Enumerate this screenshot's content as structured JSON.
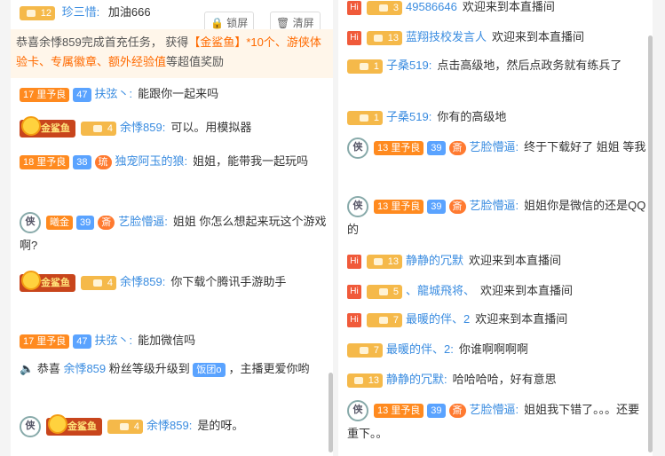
{
  "left": {
    "top_row": {
      "level": "12",
      "name": "珍三惜:",
      "msg": "加油666"
    },
    "buttons": {
      "lock": "锁屏",
      "clear": "清屏"
    },
    "notice": {
      "pre": "恭喜余悸859完成首充任务， 获得",
      "items": "【金鲨鱼】*10个、游侠体验卡、专属徽章、额外经验值",
      "post": "等超值奖励"
    },
    "rows": [
      {
        "badges": [
          {
            "type": "orange",
            "text": "里予良",
            "lv": "17"
          },
          {
            "type": "blue",
            "text": "47"
          }
        ],
        "name": "扶弦丶:",
        "msg": "能跟你一起来吗"
      },
      {
        "badges": [
          {
            "type": "gold",
            "text": "金鲨鱼"
          },
          {
            "type": "lvl",
            "text": "4"
          }
        ],
        "name": "余悸859:",
        "msg": "可以。用模拟器"
      },
      {
        "badges": [
          {
            "type": "orange",
            "text": "里予良",
            "lv": "18"
          },
          {
            "type": "blue",
            "text": "38"
          },
          {
            "type": "round",
            "text": "琉"
          }
        ],
        "name": "独宠阿玉的狼:",
        "msg": "姐姐，能带我一起玩吗"
      },
      {
        "badges": [
          {
            "type": "shield",
            "text": "侠"
          },
          {
            "type": "orange",
            "text": "曦金"
          },
          {
            "type": "blue",
            "text": "39"
          },
          {
            "type": "round",
            "text": "斎"
          }
        ],
        "name": "艺脸懵逼:",
        "msg": "姐姐 你怎么想起来玩这个游戏啊?"
      },
      {
        "badges": [
          {
            "type": "gold",
            "text": "金鲨鱼"
          },
          {
            "type": "lvl",
            "text": "4"
          }
        ],
        "name": "余悸859:",
        "msg": "你下载个腾讯手游助手"
      },
      {
        "badges": [
          {
            "type": "orange",
            "text": "里予良",
            "lv": "17"
          },
          {
            "type": "blue",
            "text": "47"
          }
        ],
        "name": "扶弦丶:",
        "msg": "能加微信吗"
      },
      {
        "upgrade": true,
        "pre": "恭喜",
        "name": "余悸859",
        "mid": "粉丝等级升级到",
        "fan": "饭团o",
        "post": "，主播更爱你哟"
      },
      {
        "badges": [
          {
            "type": "shield",
            "text": "侠"
          },
          {
            "type": "gold",
            "text": "金鲨鱼"
          },
          {
            "type": "lvl",
            "text": "4"
          }
        ],
        "name": "余悸859:",
        "msg": "是的呀。"
      }
    ]
  },
  "right": {
    "rows": [
      {
        "welcome": true,
        "lv": "3",
        "name": "49586646",
        "msg": "欢迎来到本直播间"
      },
      {
        "welcome": true,
        "lv": "13",
        "name": "蓝翔技校发言人",
        "msg": "欢迎来到本直播间"
      },
      {
        "lv": "1",
        "name": "子桑519:",
        "msg": "点击高级地，然后点政务就有练兵了"
      },
      {
        "lv": "1",
        "name": "子桑519:",
        "msg": "你有的高级地"
      },
      {
        "shield": "侠",
        "orange": "里予良",
        "olv": "13",
        "blue": "39",
        "round": "斎",
        "name": "艺脸懵逼:",
        "msg": "终于下载好了 姐姐 等我"
      },
      {
        "shield": "侠",
        "orange": "里予良",
        "olv": "13",
        "blue": "39",
        "round": "斎",
        "name": "艺脸懵逼:",
        "msg": "姐姐你是微信的还是QQ的"
      },
      {
        "welcome": true,
        "lv": "13",
        "name": "静静的冗默",
        "msg": "欢迎来到本直播间"
      },
      {
        "welcome": true,
        "lv": "5",
        "name": "、龍城飛将、",
        "msg": "欢迎来到本直播间"
      },
      {
        "welcome": true,
        "lv": "7",
        "name": "最暖的伴、2",
        "msg": "欢迎来到本直播间"
      },
      {
        "lv": "7",
        "name": "最暖的伴、2:",
        "msg": "你谁啊啊啊啊"
      },
      {
        "lv": "13",
        "name": "静静的冗默:",
        "msg": "哈哈哈哈，好有意思"
      },
      {
        "shield": "侠",
        "orange": "里予良",
        "olv": "13",
        "blue": "39",
        "round": "斎",
        "name": "艺脸懵逼:",
        "msg": "姐姐我下错了。。。还要重下。。"
      }
    ],
    "hi_label": "Hi"
  }
}
